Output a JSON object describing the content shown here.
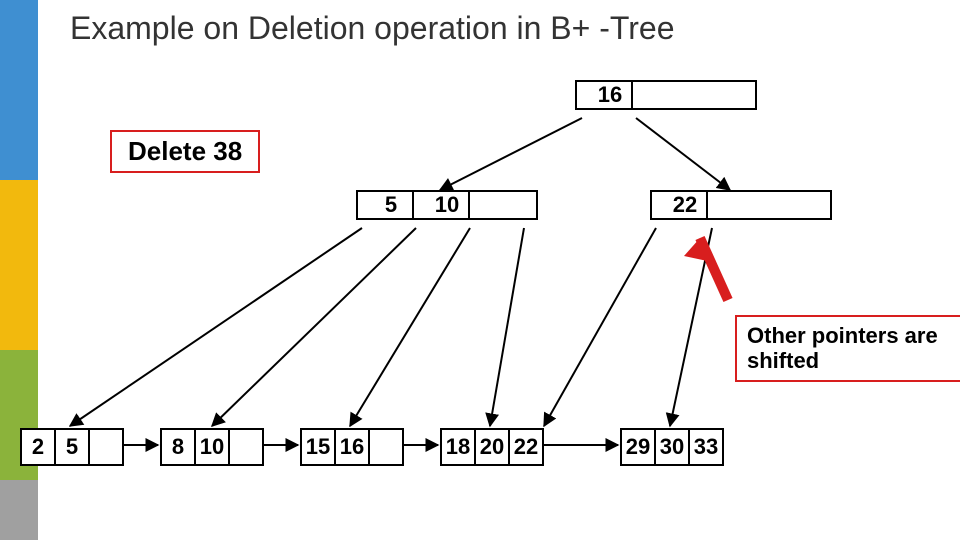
{
  "title": "Example on Deletion operation in B+ -Tree",
  "operation_label": "Delete 38",
  "annotation": "Other pointers are shifted",
  "root": {
    "keys": [
      "16",
      "",
      ""
    ]
  },
  "internal": {
    "left": {
      "keys": [
        "5",
        "10",
        ""
      ]
    },
    "right": {
      "keys": [
        "22",
        "",
        ""
      ]
    }
  },
  "leaves": [
    {
      "cells": [
        "2",
        "5",
        ""
      ]
    },
    {
      "cells": [
        "8",
        "10",
        ""
      ]
    },
    {
      "cells": [
        "15",
        "16",
        ""
      ]
    },
    {
      "cells": [
        "18",
        "20",
        "22"
      ]
    },
    {
      "cells": [
        "29",
        "30",
        "33"
      ]
    }
  ]
}
